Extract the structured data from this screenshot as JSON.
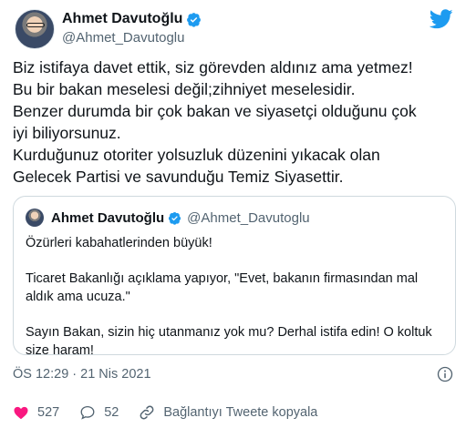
{
  "author": {
    "name": "Ahmet Davutoğlu",
    "handle": "@Ahmet_Davutoglu"
  },
  "tweet": {
    "lines": [
      "Biz istifaya davet ettik, siz görevden aldınız ama yetmez!",
      "Bu bir bakan meselesi değil;zihniyet meselesidir.",
      "Benzer durumda bir çok bakan ve siyasetçi olduğunu çok",
      "iyi biliyorsunuz.",
      "Kurduğunuz otoriter yolsuzluk düzenini yıkacak olan",
      "Gelecek Partisi ve savunduğu Temiz Siyasettir."
    ]
  },
  "quote": {
    "name": "Ahmet Davutoğlu",
    "handle": "@Ahmet_Davutoglu",
    "paragraphs": [
      "Özürleri kabahatlerinden büyük!",
      "Ticaret Bakanlığı açıklama yapıyor, \"Evet, bakanın firmasından mal aldık ama ucuza.\"",
      "Sayın Bakan, sizin hiç utanmanız yok mu? Derhal istifa edin! O koltuk size haram!"
    ]
  },
  "timestamp": "ÖS 12:29 · 21 Nis 2021",
  "actions": {
    "likes": "527",
    "replies": "52",
    "copy_link": "Bağlantıyı Tweete kopyala"
  },
  "colors": {
    "brand": "#1d9bf0",
    "like": "#f91880",
    "text": "#0f1419",
    "secondary": "#536471",
    "border": "#cfd9de"
  }
}
